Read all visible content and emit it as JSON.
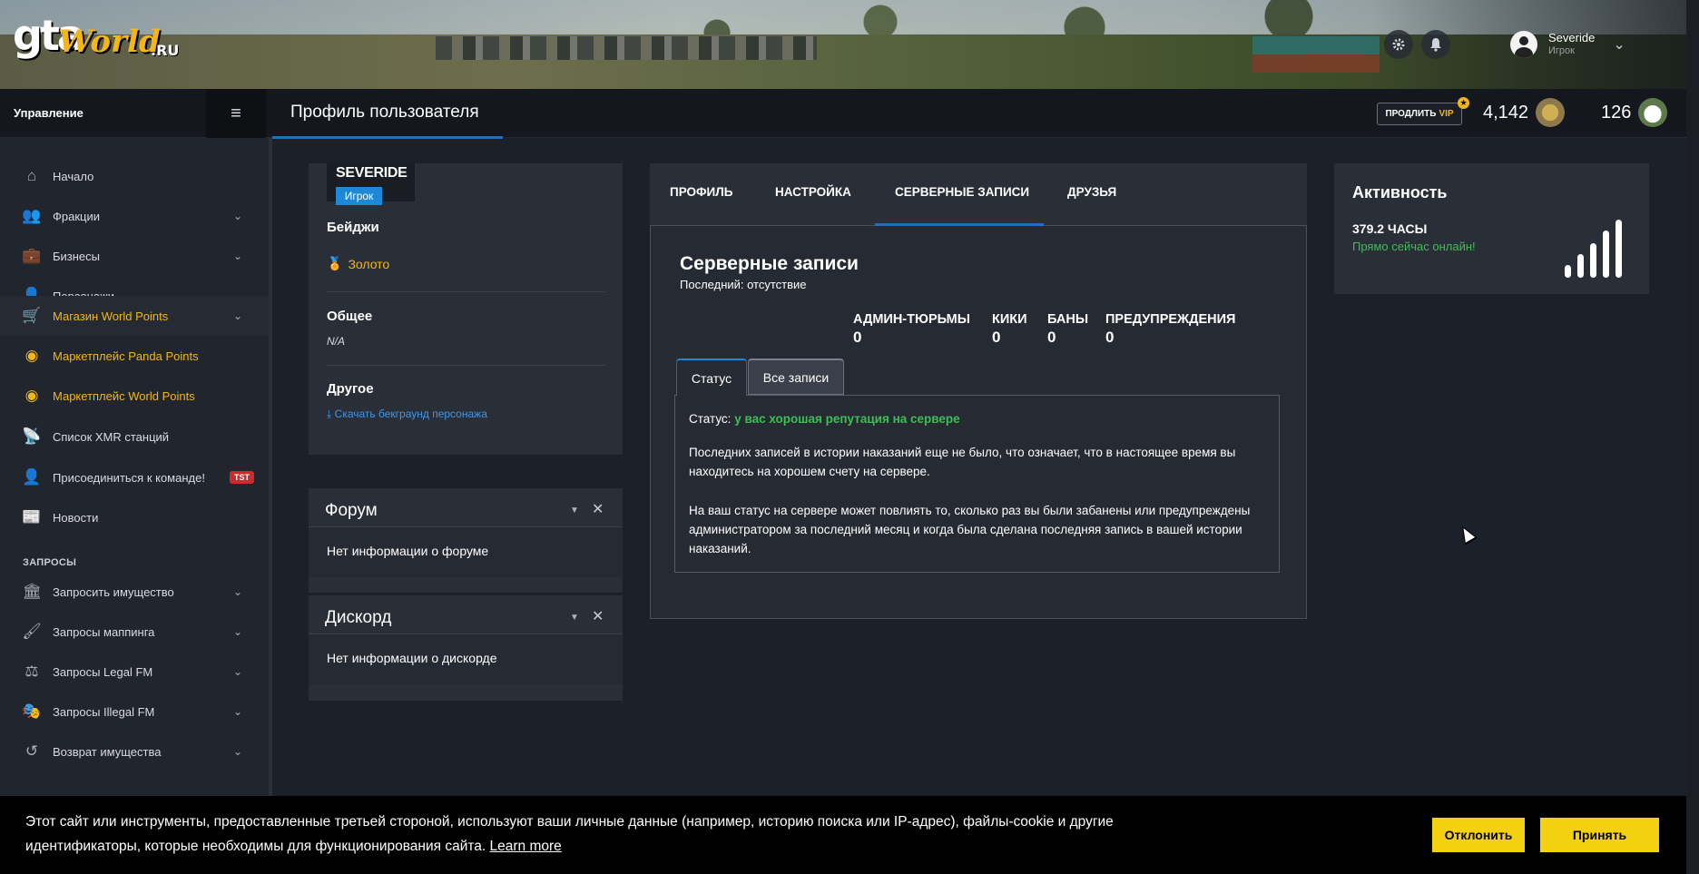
{
  "banner": {
    "logo_gta": "gta",
    "logo_world": "World",
    "logo_ru": ".RU",
    "user_name": "Severide",
    "user_role": "Игрок"
  },
  "header": {
    "management_label": "Управление",
    "page_title": "Профиль пользователя",
    "vip_prefix": "ПРОДЛИТЬ",
    "vip_word": "VIP",
    "world_points": "4,142",
    "panda_points": "126"
  },
  "sidebar": {
    "items": [
      {
        "label": "Начало",
        "icon": "home-icon"
      },
      {
        "label": "Фракции",
        "icon": "users-icon"
      },
      {
        "label": "Бизнесы",
        "icon": "briefcase-icon"
      },
      {
        "label": "Персонажи",
        "icon": "user-icon"
      },
      {
        "label": "Магазин World Points",
        "icon": "cart-icon"
      },
      {
        "label": "Маркетплейс Panda Points",
        "icon": "coins-icon"
      },
      {
        "label": "Маркетплейс World Points",
        "icon": "coins-icon"
      },
      {
        "label": "Список XMR станций",
        "icon": "antenna-icon"
      },
      {
        "label": "Присоединиться к команде!",
        "icon": "user-tie-icon",
        "badge": "TST"
      },
      {
        "label": "Новости",
        "icon": "newspaper-icon"
      }
    ],
    "section_requests": "ЗАПРОСЫ",
    "request_items": [
      {
        "label": "Запросить имущество",
        "icon": "building-icon"
      },
      {
        "label": "Запросы маппинга",
        "icon": "brush-icon"
      },
      {
        "label": "Запросы Legal FM",
        "icon": "scale-icon"
      },
      {
        "label": "Запросы Illegal FM",
        "icon": "mask-icon"
      },
      {
        "label": "Возврат имущества",
        "icon": "undo-icon"
      }
    ]
  },
  "profile": {
    "name": "SEVERIDE",
    "role": "Игрок",
    "badges_heading": "Бейджи",
    "badge_gold": "Золото",
    "general_heading": "Общее",
    "general_value": "N/A",
    "other_heading": "Другое",
    "download_link": "Скачать бекграунд персонажа"
  },
  "forum": {
    "title": "Форум",
    "text": "Нет информации о форуме"
  },
  "discord": {
    "title": "Дискорд",
    "text": "Нет информации о дискорде"
  },
  "tabs": [
    "ПРОФИЛЬ",
    "НАСТРОЙКА",
    "СЕРВЕРНЫЕ ЗАПИСИ",
    "ДРУЗЬЯ"
  ],
  "records": {
    "title": "Серверные записи",
    "last": "Последний: отсутствие",
    "stats": [
      {
        "label": "АДМИН-ТЮРЬМЫ",
        "value": "0"
      },
      {
        "label": "КИКИ",
        "value": "0"
      },
      {
        "label": "БАНЫ",
        "value": "0"
      },
      {
        "label": "ПРЕДУПРЕЖДЕНИЯ",
        "value": "0"
      }
    ],
    "subtab_status": "Статус",
    "subtab_all": "Все записи",
    "status_label": "Статус:",
    "status_value": "у вас хорошая репутация на сервере",
    "paragraph1": "Последних записей в истории наказаний еще не было, что означает, что в настоящее время вы находитесь на хорошем счету на сервере.",
    "paragraph2": "На ваш статус на сервере может повлиять то, сколько раз вы были забанены или предупреждены администратором за последний месяц и когда была сделана последняя запись в вашей истории наказаний."
  },
  "activity": {
    "title": "Активность",
    "hours": "379.2 ЧАСЫ",
    "online": "Прямо сейчас онлайн!"
  },
  "cookie": {
    "text": "Этот сайт или инструменты, предоставленные третьей стороной, используют ваши личные данные (например, историю поиска или IP-адрес), файлы-cookie и другие идентификаторы, которые необходимы для функционирования сайта.",
    "learn_more": "Learn more",
    "decline": "Отклонить",
    "accept": "Принять"
  },
  "colors": {
    "accent_blue": "#1e6fbf",
    "gold": "#f2b619",
    "status_green": "#3fbd56",
    "cookie_button": "#f3d10e",
    "tst_badge": "#cc2b2b"
  }
}
